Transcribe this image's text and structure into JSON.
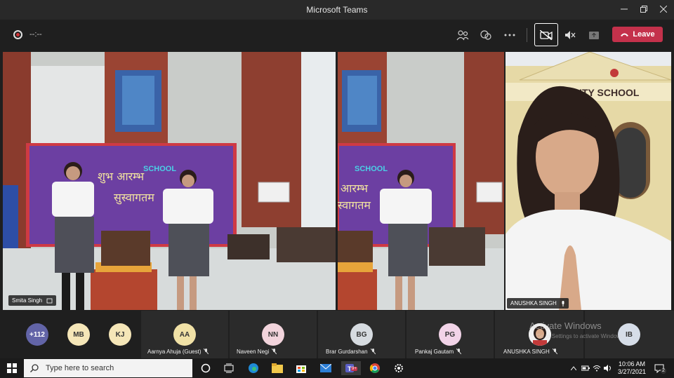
{
  "window": {
    "title": "Microsoft Teams"
  },
  "toolbar": {
    "timer": "--:--",
    "leave_label": "Leave"
  },
  "video": {
    "tile1_name": "Smita Singh",
    "tile3_name": "ANUSHKA SINGH",
    "school_sign": "CITY SCHOOL",
    "banner_line1": "शुभ आरम्भ",
    "banner_line2": "सुस्वागतम",
    "banner_school": "SCHOOL",
    "banner_line1_crop": "आरम्भ",
    "banner_line2_crop": "स्वागतम"
  },
  "participants": [
    {
      "initials": "+112",
      "name": "",
      "color": "#6264a7"
    },
    {
      "initials": "MB",
      "name": "",
      "color": "#f5e6b8"
    },
    {
      "initials": "KJ",
      "name": "",
      "color": "#f5e6b8"
    },
    {
      "initials": "AA",
      "name": "Aarnya Ahuja (Guest)",
      "color": "#f0e1a6"
    },
    {
      "initials": "NN",
      "name": "Naveen Negi",
      "color": "#f2d4dc"
    },
    {
      "initials": "BG",
      "name": "Brar Gurdarshan",
      "color": "#d6dbe0"
    },
    {
      "initials": "PG",
      "name": "Pankaj Gautam",
      "color": "#f2d4e8"
    },
    {
      "initials": "",
      "name": "ANUSHKA SINGH",
      "color": "#ffffff"
    },
    {
      "initials": "IB",
      "name": "",
      "color": "#d6dde8"
    }
  ],
  "watermark": {
    "line1": "Activate Windows",
    "line2": "Go to Settings to activate Windows."
  },
  "taskbar": {
    "search_placeholder": "Type here to search",
    "teams_badge": "9+",
    "time": "10:06 AM",
    "date": "3/27/2021",
    "notification_count": "2"
  }
}
